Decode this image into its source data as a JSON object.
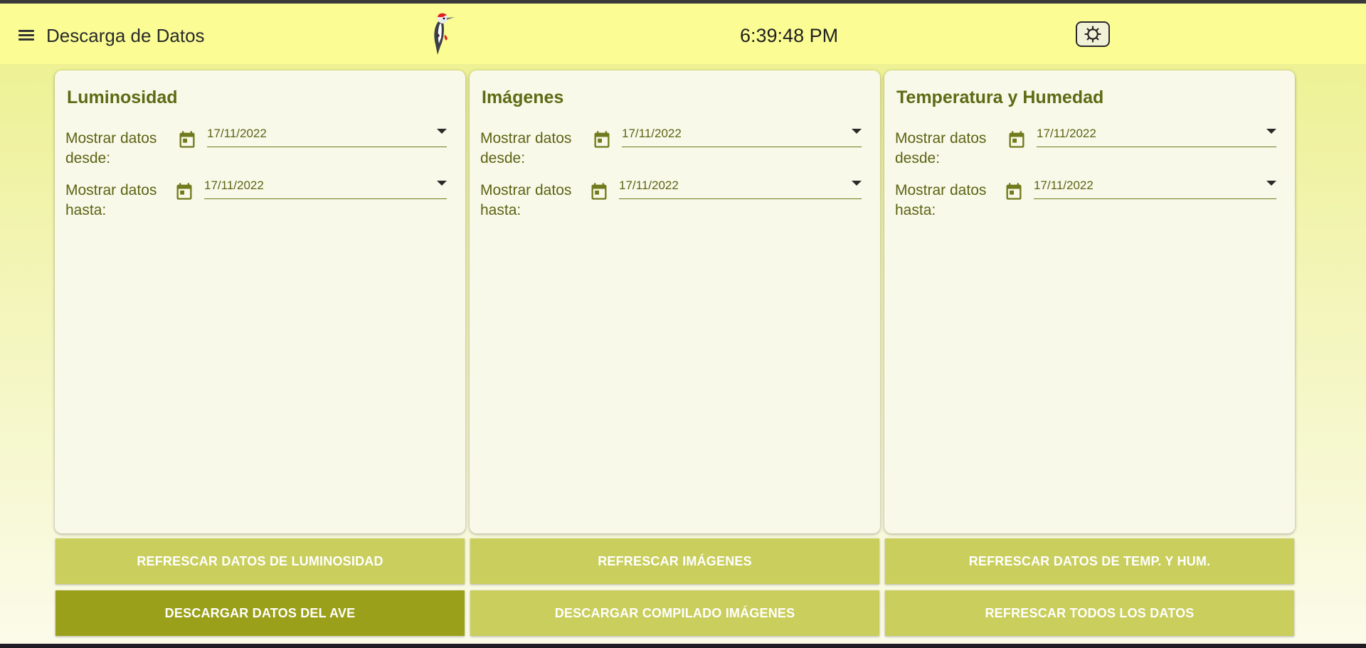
{
  "header": {
    "title": "Descarga de Datos",
    "clock": "6:39:48 PM",
    "menu_icon": "hamburger-menu-icon",
    "logo_icon": "woodpecker-logo-icon",
    "settings_icon": "gear-icon"
  },
  "colors": {
    "header_bg": "#fbfd94",
    "card_bg": "#f8f9e8",
    "accent_text": "#5e6a14",
    "button": "#c9ce5c",
    "button_primary": "#9ba01a"
  },
  "cards": [
    {
      "title": "Luminosidad",
      "from_label": "Mostrar datos desde:",
      "from_date": "17/11/2022",
      "to_label": "Mostrar datos hasta:",
      "to_date": "17/11/2022"
    },
    {
      "title": "Imágenes",
      "from_label": "Mostrar datos desde:",
      "from_date": "17/11/2022",
      "to_label": "Mostrar datos hasta:",
      "to_date": "17/11/2022"
    },
    {
      "title": "Temperatura y Humedad",
      "from_label": "Mostrar datos desde:",
      "from_date": "17/11/2022",
      "to_label": "Mostrar datos hasta:",
      "to_date": "17/11/2022"
    }
  ],
  "buttons": {
    "refresh_luminosity": "REFRESCAR DATOS DE LUMINOSIDAD",
    "refresh_images": "REFRESCAR IMÁGENES",
    "refresh_temp_hum": "REFRESCAR DATOS DE TEMP. Y HUM.",
    "download_bird_data": "DESCARGAR DATOS DEL AVE",
    "download_images_compilation": "DESCARGAR COMPILADO IMÁGENES",
    "refresh_all": "REFRESCAR TODOS LOS DATOS"
  }
}
